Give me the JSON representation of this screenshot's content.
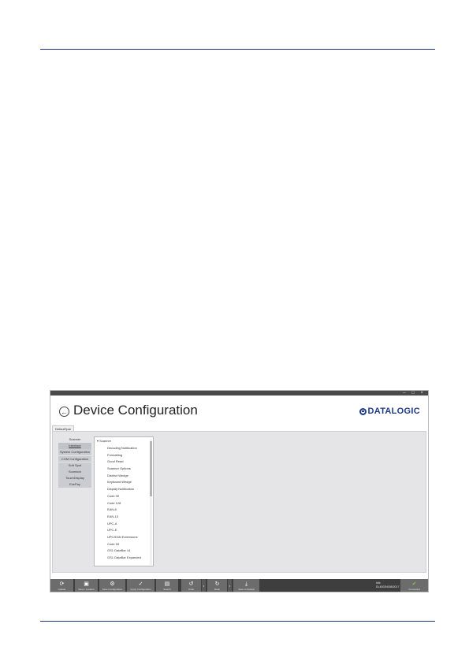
{
  "window": {
    "controls": "– □ ×"
  },
  "header": {
    "back_icon": "back-arrow-icon",
    "title": "Device Configuration",
    "logo_text": "DATALOGIC",
    "brand_color": "#1f3a8a"
  },
  "tab": {
    "label": "Default*par"
  },
  "nav": {
    "items": [
      {
        "label": "Scanner"
      },
      {
        "label": "Interface"
      },
      {
        "label": "System Configuration"
      },
      {
        "label": "COM Configuration"
      },
      {
        "label": "Soft Spot"
      },
      {
        "label": "Scanlock"
      },
      {
        "label": "TouchDisplay"
      },
      {
        "label": "EzePay"
      }
    ],
    "selected_index": 1
  },
  "tree": {
    "root": "Scanner",
    "items": [
      {
        "label": "Decoding Notification"
      },
      {
        "label": "Formatting"
      },
      {
        "label": "Good Read"
      },
      {
        "label": "Scanner Options"
      },
      {
        "label": "Distinct Wedge"
      },
      {
        "label": "Keyboard Wedge"
      },
      {
        "label": "Display Notification"
      },
      {
        "label": "Code 39"
      },
      {
        "label": "Code 128"
      },
      {
        "label": "EAN-8"
      },
      {
        "label": "EAN-13"
      },
      {
        "label": "UPC-A"
      },
      {
        "label": "UPC-E"
      },
      {
        "label": "UPC/EAN Extensions"
      },
      {
        "label": "Code 93"
      },
      {
        "label": "GS1 DataBar 14"
      },
      {
        "label": "GS1 DataBar Expanded"
      }
    ]
  },
  "toolbar": {
    "buttons": [
      {
        "label": "Update",
        "icon": "refresh-icon"
      },
      {
        "label": "Save / Loaders",
        "icon": "save-icon"
      },
      {
        "label": "Save Configuration",
        "icon": "settings-icon"
      },
      {
        "label": "Apply Configuration",
        "icon": "check-icon"
      },
      {
        "label": "Search",
        "icon": "search-icon"
      },
      {
        "label": "Undo",
        "icon": "undo-icon"
      },
      {
        "label": "Redo",
        "icon": "redo-icon"
      },
      {
        "label": "Save to Default",
        "icon": "download-icon"
      }
    ],
    "status_line1": "Idle",
    "status_line2": "DL4002N008/2017",
    "connect_label": "Connected"
  }
}
